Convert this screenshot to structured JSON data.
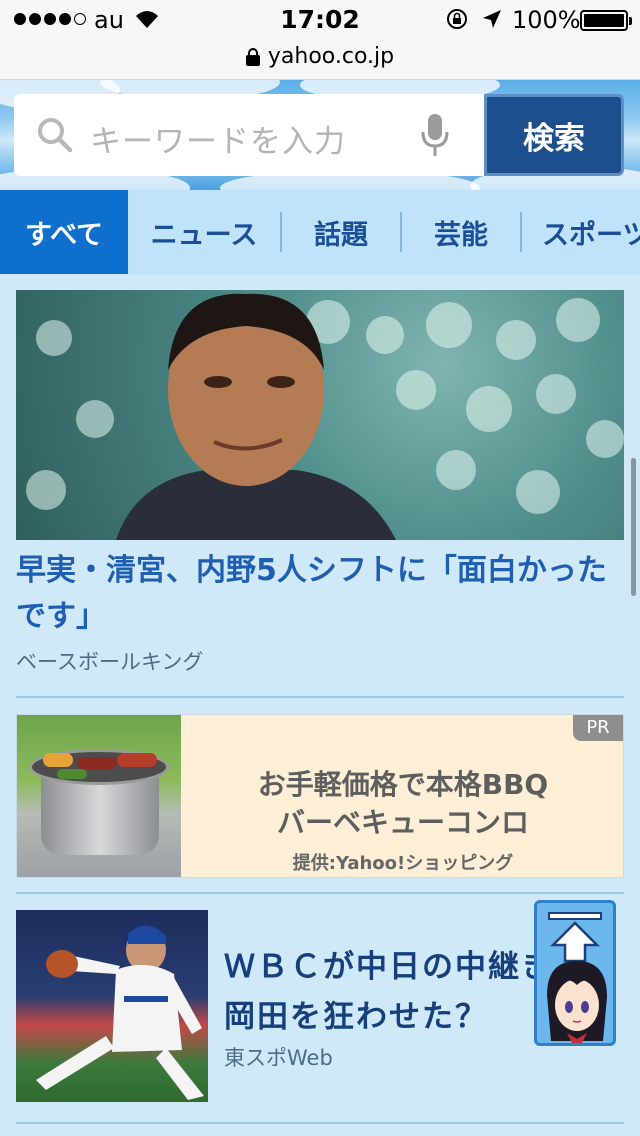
{
  "status_bar": {
    "carrier": "au",
    "time": "17:02",
    "battery_percent": "100%",
    "signal_bars_filled": 4,
    "signal_bars_total": 5
  },
  "browser": {
    "url": "yahoo.co.jp"
  },
  "search": {
    "placeholder": "キーワードを入力",
    "button_label": "検索"
  },
  "tabs": [
    {
      "label": "すべて",
      "active": true
    },
    {
      "label": "ニュース",
      "active": false
    },
    {
      "label": "話題",
      "active": false
    },
    {
      "label": "芸能",
      "active": false
    },
    {
      "label": "スポーツ",
      "active": false
    }
  ],
  "feed": {
    "articles": [
      {
        "headline": "早実・清宮、内野5人シフトに「面白かったです」",
        "source": "ベースボールキング"
      },
      {
        "headline": "ＷＢＣが中日の中継きス・岡田を狂わせた？",
        "source": "東スポWeb"
      }
    ],
    "ad": {
      "badge": "PR",
      "line1": "お手軽価格で本格BBQ",
      "line2": "バーベキューコンロ",
      "provider": "提供:Yahoo!ショッピング"
    }
  },
  "colors": {
    "active_tab": "#0f6fcd",
    "tab_text": "#1a4f98",
    "headline": "#1f5fb1",
    "search_button": "#1d4f8e",
    "background": "#cfe9f8"
  },
  "icons": [
    "search-icon",
    "mic-icon",
    "wifi-icon",
    "padlock-icon",
    "location-arrow-icon",
    "rotation-lock-icon",
    "back-to-top-icon"
  ]
}
